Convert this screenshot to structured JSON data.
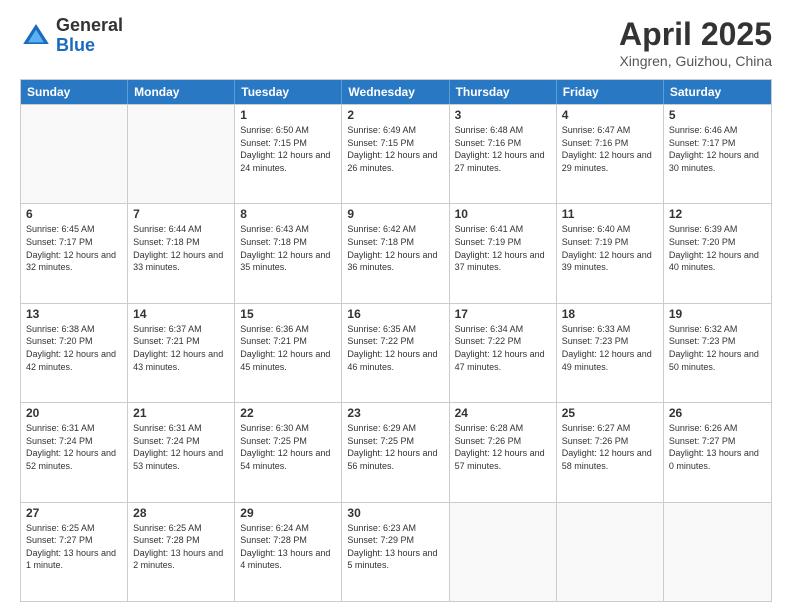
{
  "header": {
    "logo_general": "General",
    "logo_blue": "Blue",
    "month_year": "April 2025",
    "location": "Xingren, Guizhou, China"
  },
  "weekdays": [
    "Sunday",
    "Monday",
    "Tuesday",
    "Wednesday",
    "Thursday",
    "Friday",
    "Saturday"
  ],
  "rows": [
    [
      {
        "day": "",
        "empty": true
      },
      {
        "day": "",
        "empty": true
      },
      {
        "day": "1",
        "sunrise": "Sunrise: 6:50 AM",
        "sunset": "Sunset: 7:15 PM",
        "daylight": "Daylight: 12 hours and 24 minutes."
      },
      {
        "day": "2",
        "sunrise": "Sunrise: 6:49 AM",
        "sunset": "Sunset: 7:15 PM",
        "daylight": "Daylight: 12 hours and 26 minutes."
      },
      {
        "day": "3",
        "sunrise": "Sunrise: 6:48 AM",
        "sunset": "Sunset: 7:16 PM",
        "daylight": "Daylight: 12 hours and 27 minutes."
      },
      {
        "day": "4",
        "sunrise": "Sunrise: 6:47 AM",
        "sunset": "Sunset: 7:16 PM",
        "daylight": "Daylight: 12 hours and 29 minutes."
      },
      {
        "day": "5",
        "sunrise": "Sunrise: 6:46 AM",
        "sunset": "Sunset: 7:17 PM",
        "daylight": "Daylight: 12 hours and 30 minutes."
      }
    ],
    [
      {
        "day": "6",
        "sunrise": "Sunrise: 6:45 AM",
        "sunset": "Sunset: 7:17 PM",
        "daylight": "Daylight: 12 hours and 32 minutes."
      },
      {
        "day": "7",
        "sunrise": "Sunrise: 6:44 AM",
        "sunset": "Sunset: 7:18 PM",
        "daylight": "Daylight: 12 hours and 33 minutes."
      },
      {
        "day": "8",
        "sunrise": "Sunrise: 6:43 AM",
        "sunset": "Sunset: 7:18 PM",
        "daylight": "Daylight: 12 hours and 35 minutes."
      },
      {
        "day": "9",
        "sunrise": "Sunrise: 6:42 AM",
        "sunset": "Sunset: 7:18 PM",
        "daylight": "Daylight: 12 hours and 36 minutes."
      },
      {
        "day": "10",
        "sunrise": "Sunrise: 6:41 AM",
        "sunset": "Sunset: 7:19 PM",
        "daylight": "Daylight: 12 hours and 37 minutes."
      },
      {
        "day": "11",
        "sunrise": "Sunrise: 6:40 AM",
        "sunset": "Sunset: 7:19 PM",
        "daylight": "Daylight: 12 hours and 39 minutes."
      },
      {
        "day": "12",
        "sunrise": "Sunrise: 6:39 AM",
        "sunset": "Sunset: 7:20 PM",
        "daylight": "Daylight: 12 hours and 40 minutes."
      }
    ],
    [
      {
        "day": "13",
        "sunrise": "Sunrise: 6:38 AM",
        "sunset": "Sunset: 7:20 PM",
        "daylight": "Daylight: 12 hours and 42 minutes."
      },
      {
        "day": "14",
        "sunrise": "Sunrise: 6:37 AM",
        "sunset": "Sunset: 7:21 PM",
        "daylight": "Daylight: 12 hours and 43 minutes."
      },
      {
        "day": "15",
        "sunrise": "Sunrise: 6:36 AM",
        "sunset": "Sunset: 7:21 PM",
        "daylight": "Daylight: 12 hours and 45 minutes."
      },
      {
        "day": "16",
        "sunrise": "Sunrise: 6:35 AM",
        "sunset": "Sunset: 7:22 PM",
        "daylight": "Daylight: 12 hours and 46 minutes."
      },
      {
        "day": "17",
        "sunrise": "Sunrise: 6:34 AM",
        "sunset": "Sunset: 7:22 PM",
        "daylight": "Daylight: 12 hours and 47 minutes."
      },
      {
        "day": "18",
        "sunrise": "Sunrise: 6:33 AM",
        "sunset": "Sunset: 7:23 PM",
        "daylight": "Daylight: 12 hours and 49 minutes."
      },
      {
        "day": "19",
        "sunrise": "Sunrise: 6:32 AM",
        "sunset": "Sunset: 7:23 PM",
        "daylight": "Daylight: 12 hours and 50 minutes."
      }
    ],
    [
      {
        "day": "20",
        "sunrise": "Sunrise: 6:31 AM",
        "sunset": "Sunset: 7:24 PM",
        "daylight": "Daylight: 12 hours and 52 minutes."
      },
      {
        "day": "21",
        "sunrise": "Sunrise: 6:31 AM",
        "sunset": "Sunset: 7:24 PM",
        "daylight": "Daylight: 12 hours and 53 minutes."
      },
      {
        "day": "22",
        "sunrise": "Sunrise: 6:30 AM",
        "sunset": "Sunset: 7:25 PM",
        "daylight": "Daylight: 12 hours and 54 minutes."
      },
      {
        "day": "23",
        "sunrise": "Sunrise: 6:29 AM",
        "sunset": "Sunset: 7:25 PM",
        "daylight": "Daylight: 12 hours and 56 minutes."
      },
      {
        "day": "24",
        "sunrise": "Sunrise: 6:28 AM",
        "sunset": "Sunset: 7:26 PM",
        "daylight": "Daylight: 12 hours and 57 minutes."
      },
      {
        "day": "25",
        "sunrise": "Sunrise: 6:27 AM",
        "sunset": "Sunset: 7:26 PM",
        "daylight": "Daylight: 12 hours and 58 minutes."
      },
      {
        "day": "26",
        "sunrise": "Sunrise: 6:26 AM",
        "sunset": "Sunset: 7:27 PM",
        "daylight": "Daylight: 13 hours and 0 minutes."
      }
    ],
    [
      {
        "day": "27",
        "sunrise": "Sunrise: 6:25 AM",
        "sunset": "Sunset: 7:27 PM",
        "daylight": "Daylight: 13 hours and 1 minute."
      },
      {
        "day": "28",
        "sunrise": "Sunrise: 6:25 AM",
        "sunset": "Sunset: 7:28 PM",
        "daylight": "Daylight: 13 hours and 2 minutes."
      },
      {
        "day": "29",
        "sunrise": "Sunrise: 6:24 AM",
        "sunset": "Sunset: 7:28 PM",
        "daylight": "Daylight: 13 hours and 4 minutes."
      },
      {
        "day": "30",
        "sunrise": "Sunrise: 6:23 AM",
        "sunset": "Sunset: 7:29 PM",
        "daylight": "Daylight: 13 hours and 5 minutes."
      },
      {
        "day": "",
        "empty": true
      },
      {
        "day": "",
        "empty": true
      },
      {
        "day": "",
        "empty": true
      }
    ]
  ]
}
